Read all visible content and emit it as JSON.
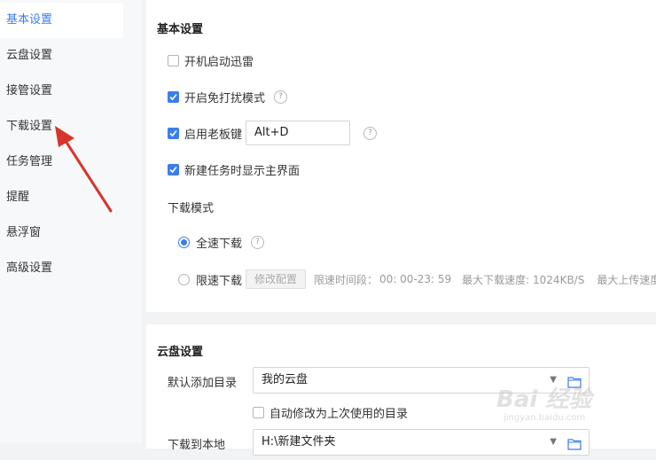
{
  "sidebar": {
    "items": [
      {
        "label": "基本设置",
        "active": true
      },
      {
        "label": "云盘设置"
      },
      {
        "label": "接管设置"
      },
      {
        "label": "下载设置"
      },
      {
        "label": "任务管理"
      },
      {
        "label": "提醒"
      },
      {
        "label": "悬浮窗"
      },
      {
        "label": "高级设置"
      }
    ]
  },
  "basic": {
    "title": "基本设置",
    "options": {
      "startup": {
        "label": "开机启动迅雷",
        "checked": false
      },
      "no_disturb": {
        "label": "开启免打扰模式",
        "checked": true
      },
      "boss_key": {
        "label": "启用老板键",
        "checked": true,
        "value": "Alt+D"
      },
      "show_main": {
        "label": "新建任务时显示主界面",
        "checked": true
      }
    },
    "download_mode": {
      "label": "下载模式",
      "full_speed": "全速下载",
      "limited": "限速下载",
      "modify_button": "修改配置",
      "limit_period": "限速时间段：",
      "time_range": "00: 00-23: 59",
      "max_download": "最大下载速度: 1024KB/S",
      "max_upload": "最大上传速度: 1"
    }
  },
  "cloud": {
    "title": "云盘设置",
    "default_dir_label": "默认添加目录",
    "default_dir_value": "我的云盘",
    "auto_modify_label": "自动修改为上次使用的目录",
    "download_local_label": "下载到本地",
    "download_local_value": "H:\\新建文件夹"
  },
  "watermark": {
    "brand": "Bai 经验",
    "url": "jingyan.baidu.com"
  },
  "colors": {
    "accent": "#3b7df0",
    "arrow": "#d9342b"
  }
}
